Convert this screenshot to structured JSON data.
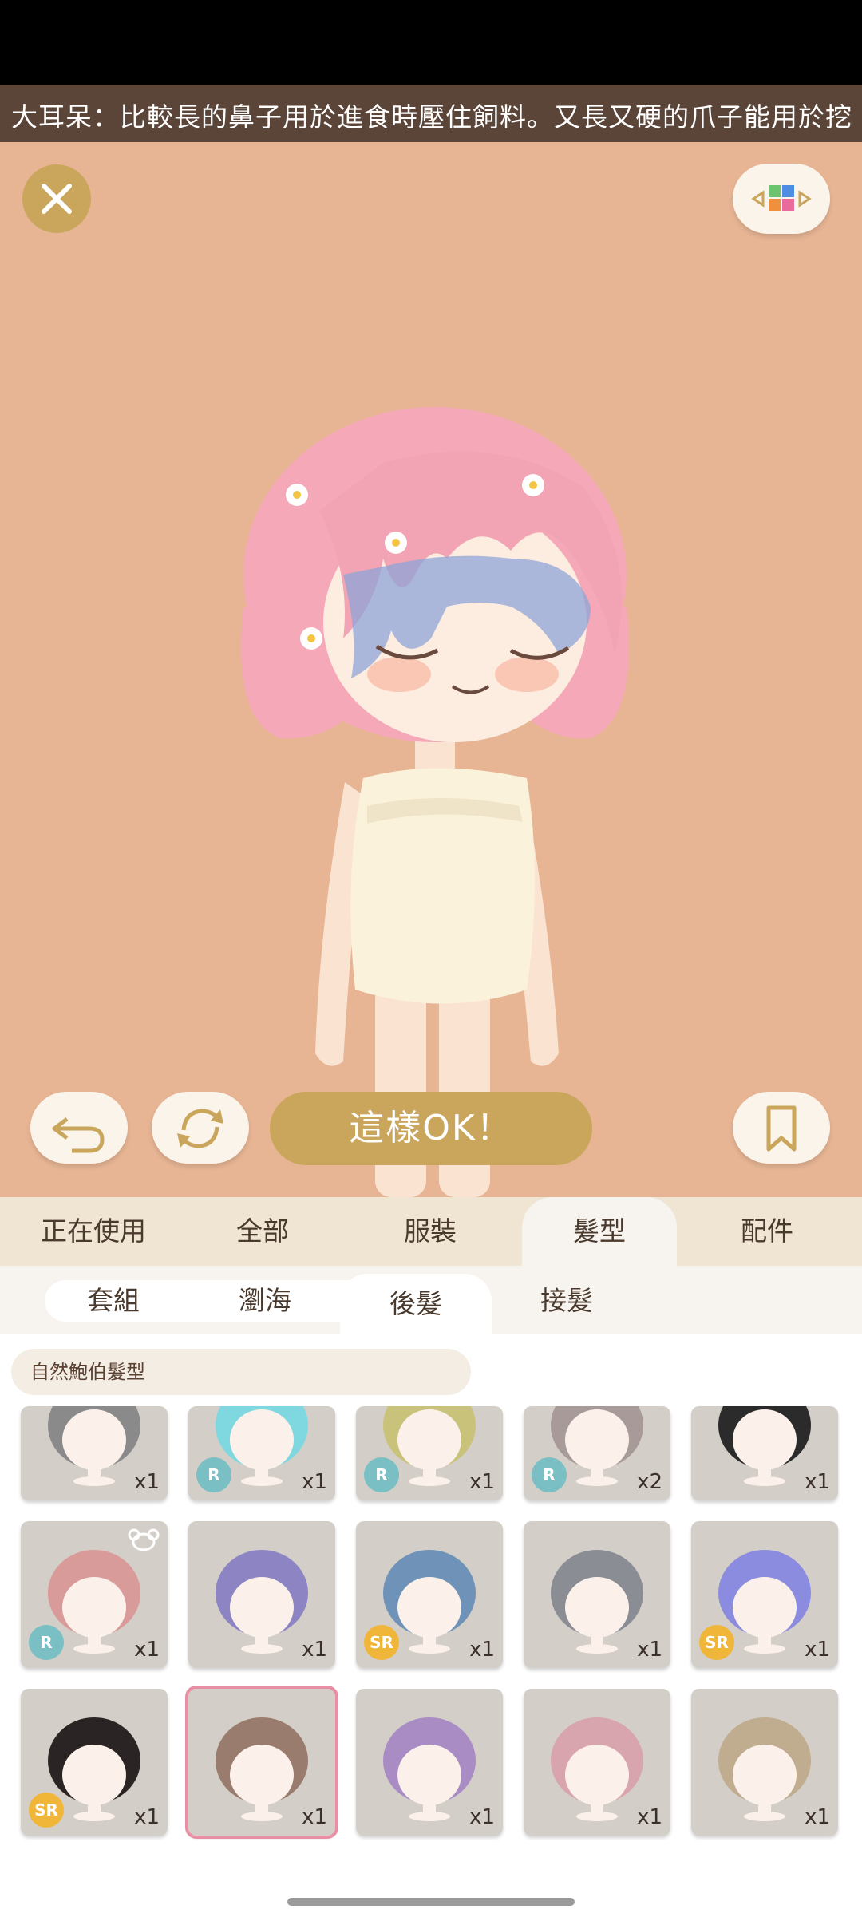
{
  "ticker": {
    "text": "大耳呆：比較長的鼻子用於進食時壓住飼料。又長又硬的爪子能用於挖"
  },
  "buttons": {
    "ok_label": "這樣OK！"
  },
  "tabs": [
    {
      "label": "正在使用"
    },
    {
      "label": "全部"
    },
    {
      "label": "服裝"
    },
    {
      "label": "髮型"
    },
    {
      "label": "配件"
    }
  ],
  "subtabs": [
    {
      "label": "套組"
    },
    {
      "label": "瀏海"
    },
    {
      "label": "後髮"
    },
    {
      "label": "接髮"
    }
  ],
  "category_label": "自然鮑伯髮型",
  "items": [
    {
      "count": "x1",
      "rarity": "",
      "hair": "#8a8a8a"
    },
    {
      "count": "x1",
      "rarity": "R",
      "hair": "#7fd8e0"
    },
    {
      "count": "x1",
      "rarity": "R",
      "hair": "#c9c27a"
    },
    {
      "count": "x2",
      "rarity": "R",
      "hair": "#a79a98"
    },
    {
      "count": "x1",
      "rarity": "",
      "hair": "#2b2b2b"
    },
    {
      "count": "x1",
      "rarity": "R",
      "hair": "#d99a9a"
    },
    {
      "count": "x1",
      "rarity": "",
      "hair": "#8d84c4"
    },
    {
      "count": "x1",
      "rarity": "SR",
      "hair": "#6f93b8"
    },
    {
      "count": "x1",
      "rarity": "",
      "hair": "#8a8d94"
    },
    {
      "count": "x1",
      "rarity": "SR",
      "hair": "#8b8be0"
    },
    {
      "count": "x1",
      "rarity": "SR",
      "hair": "#2a2524"
    },
    {
      "count": "x1",
      "rarity": "",
      "hair": "#9a7c6e"
    },
    {
      "count": "x1",
      "rarity": "",
      "hair": "#a98cc4"
    },
    {
      "count": "x1",
      "rarity": "",
      "hair": "#d8a4ad"
    },
    {
      "count": "x1",
      "rarity": "",
      "hair": "#c0ac8f"
    }
  ],
  "colors": {
    "accent": "#c9a65b",
    "stage_bg": "#e7b594",
    "selected_border": "#e88ea5"
  }
}
